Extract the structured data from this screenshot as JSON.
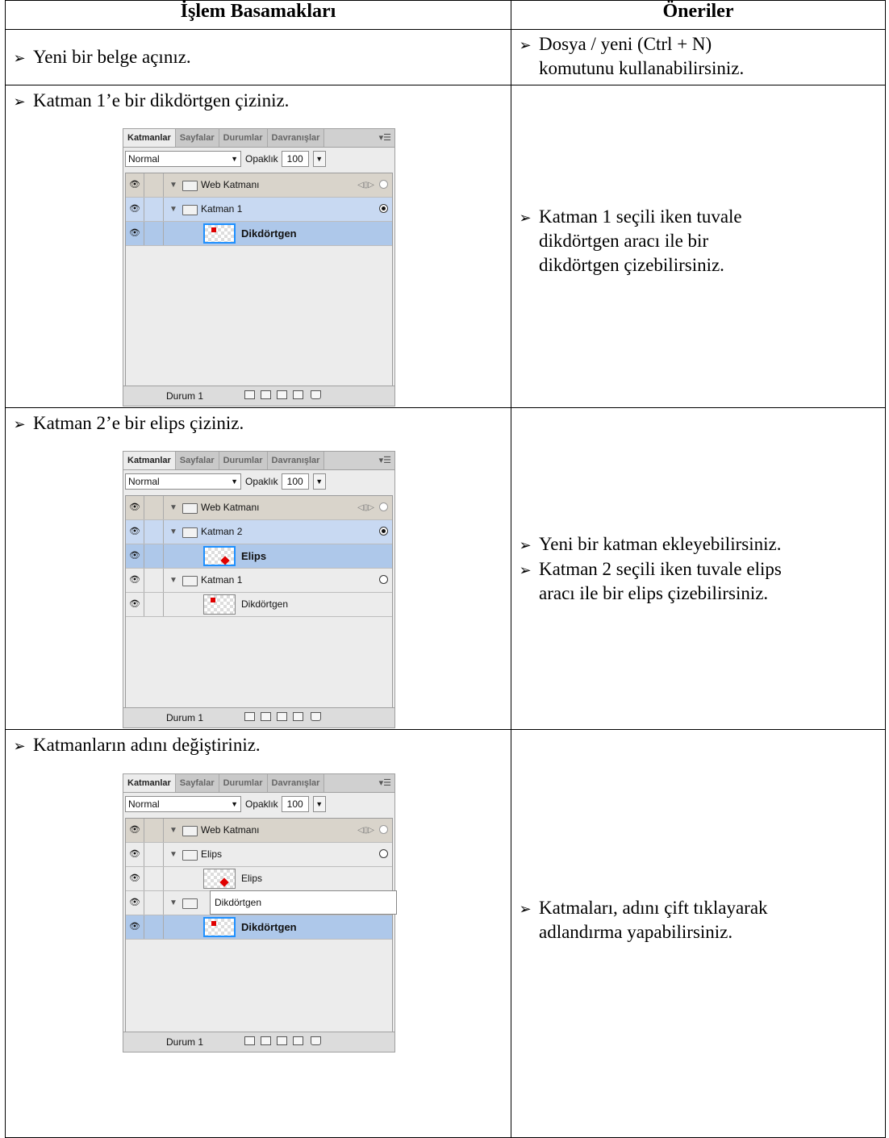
{
  "headers": {
    "steps": "İşlem Basamakları",
    "tips": "Öneriler"
  },
  "rows": [
    {
      "step": "Yeni bir belge açınız.",
      "tip_lines": [
        "Dosya / yeni (Ctrl + N)",
        "komutunu kullanabilirsiniz."
      ]
    },
    {
      "step": "Katman 1’e bir dikdörtgen çiziniz.",
      "tip_lines": [
        "Katman 1 seçili iken tuvale",
        "dikdörtgen aracı ile bir",
        "dikdörtgen çizebilirsiniz."
      ]
    },
    {
      "step": "Katman 2’e bir elips çiziniz.",
      "tips": [
        {
          "lines": [
            "Yeni bir katman ekleyebilirsiniz."
          ]
        },
        {
          "lines": [
            "Katman 2 seçili iken tuvale elips",
            "aracı ile bir elips çizebilirsiniz."
          ]
        }
      ]
    },
    {
      "step": "Katmanların adını değiştiriniz.",
      "tip_lines": [
        "Katmaları, adını çift tıklayarak",
        "adlandırma yapabilirsiniz."
      ]
    }
  ],
  "panel": {
    "tabs": [
      "Katmanlar",
      "Sayfalar",
      "Durumlar",
      "Davranışlar"
    ],
    "blend_mode": "Normal",
    "opacity_label": "Opaklık",
    "opacity_value": "100",
    "state": "Durum 1",
    "panel1": {
      "web": "Web Katmanı",
      "layer1": "Katman 1",
      "obj1": "Dikdörtgen"
    },
    "panel2": {
      "web": "Web Katmanı",
      "layer2": "Katman 2",
      "obj2": "Elips",
      "layer1": "Katman 1",
      "obj1": "Dikdörtgen"
    },
    "panel3": {
      "web": "Web Katmanı",
      "layerE": "Elips",
      "objE": "Elips",
      "rename_value": "Dikdörtgen",
      "objD": "Dikdörtgen"
    }
  },
  "icons": {
    "bullet": "arrow-bullet-icon",
    "eye": "eye-icon",
    "folder": "folder-icon"
  }
}
